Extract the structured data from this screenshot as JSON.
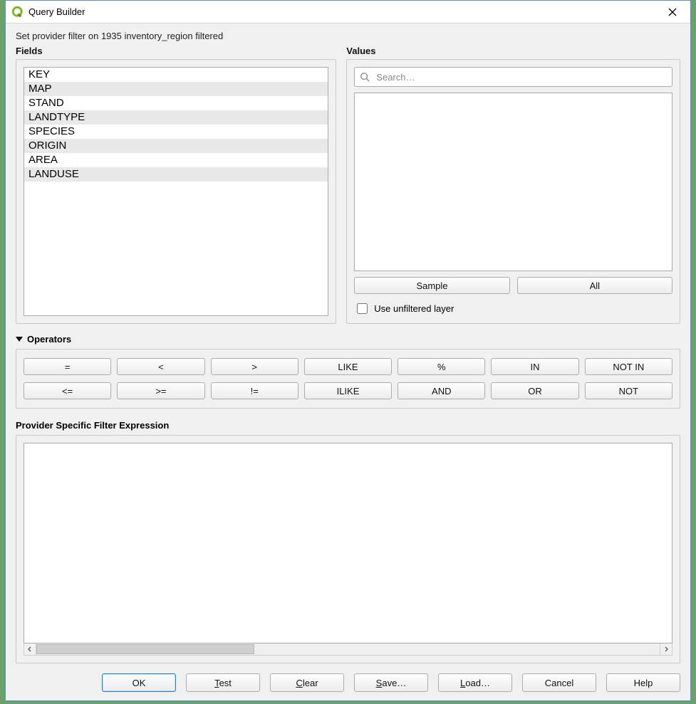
{
  "window": {
    "title": "Query Builder"
  },
  "context_line": "Set provider filter on 1935 inventory_region filtered",
  "fields": {
    "label": "Fields",
    "items": [
      "KEY",
      "MAP",
      "STAND",
      "LANDTYPE",
      "SPECIES",
      "ORIGIN",
      "AREA",
      "LANDUSE"
    ]
  },
  "values": {
    "label": "Values",
    "search_placeholder": "Search…",
    "sample_label": "Sample",
    "all_label": "All",
    "checkbox_label": "Use unfiltered layer"
  },
  "operators": {
    "label": "Operators",
    "row1": [
      "=",
      "<",
      ">",
      "LIKE",
      "%",
      "IN",
      "NOT IN"
    ],
    "row2": [
      "<=",
      ">=",
      "!=",
      "ILIKE",
      "AND",
      "OR",
      "NOT"
    ]
  },
  "expression": {
    "label": "Provider Specific Filter Expression",
    "value": ""
  },
  "buttons": {
    "ok": "OK",
    "test": "Test",
    "clear": "Clear",
    "save": "Save…",
    "load": "Load…",
    "cancel": "Cancel",
    "help": "Help"
  }
}
